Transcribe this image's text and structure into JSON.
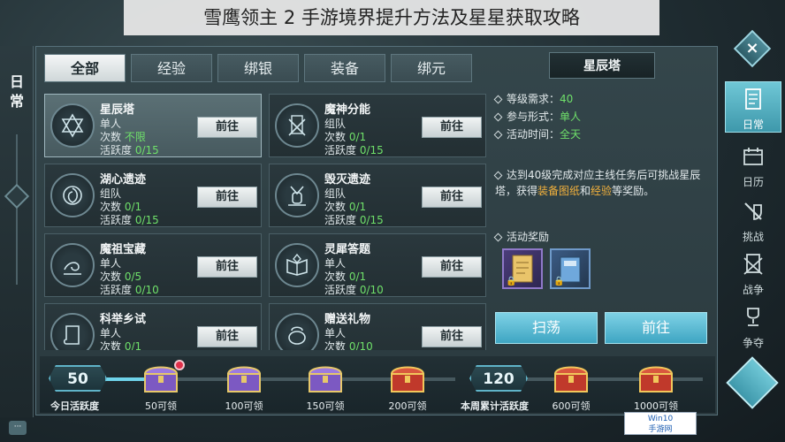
{
  "banner": {
    "title": "雪鹰领主 2 手游境界提升方法及星星获取攻略"
  },
  "left_rail": {
    "title": "日常"
  },
  "tabs": [
    {
      "label": "全部",
      "active": true
    },
    {
      "label": "经验",
      "active": false
    },
    {
      "label": "绑银",
      "active": false
    },
    {
      "label": "装备",
      "active": false
    },
    {
      "label": "绑元",
      "active": false
    }
  ],
  "tasks": [
    {
      "name": "星辰塔",
      "mode": "单人",
      "count_label": "次数",
      "count_value": "不限",
      "activity_label": "活跃度",
      "activity_value": "0/15",
      "button": "前往",
      "icon": "hexagram-icon",
      "selected": true
    },
    {
      "name": "魔神分能",
      "mode": "组队",
      "count_label": "次数",
      "count_value": "0/1",
      "activity_label": "活跃度",
      "activity_value": "0/15",
      "button": "前往",
      "icon": "banner-swords-icon",
      "selected": false
    },
    {
      "name": "湖心遗迹",
      "mode": "组队",
      "count_label": "次数",
      "count_value": "0/1",
      "activity_label": "活跃度",
      "activity_value": "0/15",
      "button": "前往",
      "icon": "vortex-icon",
      "selected": false
    },
    {
      "name": "毁灭遗迹",
      "mode": "组队",
      "count_label": "次数",
      "count_value": "0/1",
      "activity_label": "活跃度",
      "activity_value": "0/15",
      "button": "前往",
      "icon": "crossed-swords-icon",
      "selected": false
    },
    {
      "name": "魔祖宝藏",
      "mode": "单人",
      "count_label": "次数",
      "count_value": "0/5",
      "activity_label": "活跃度",
      "activity_value": "0/10",
      "button": "前往",
      "icon": "swirl-icon",
      "selected": false
    },
    {
      "name": "灵犀答题",
      "mode": "单人",
      "count_label": "次数",
      "count_value": "0/1",
      "activity_label": "活跃度",
      "activity_value": "0/10",
      "button": "前往",
      "icon": "book-icon",
      "selected": false
    },
    {
      "name": "科举乡试",
      "mode": "单人",
      "count_label": "次数",
      "count_value": "0/1",
      "activity_label": "",
      "activity_value": "",
      "button": "前往",
      "icon": "scroll-icon",
      "selected": false
    },
    {
      "name": "赠送礼物",
      "mode": "单人",
      "count_label": "次数",
      "count_value": "0/10",
      "activity_label": "",
      "activity_value": "",
      "button": "前往",
      "icon": "gift-bag-icon",
      "selected": false
    }
  ],
  "detail": {
    "title": "星辰塔",
    "level_label": "等级需求：",
    "level_value": "40",
    "mode_label": "参与形式：",
    "mode_value": "单人",
    "time_label": "活动时间：",
    "time_value": "全天",
    "desc_prefix": "达到40级完成对应主线任务后可挑战星辰塔，获得",
    "desc_highlight1": "装备图纸",
    "desc_mid": "和",
    "desc_highlight2": "经验",
    "desc_suffix": "等奖励。",
    "reward_label": "活动奖励",
    "sweep_button": "扫荡",
    "go_button": "前往"
  },
  "progress": {
    "today_value": "50",
    "today_label": "今日活跃度",
    "today_fraction": 0.12,
    "week_value": "120",
    "week_label": "本周累计活跃度",
    "week_fraction": 0.0,
    "chests": [
      {
        "label": "50可领",
        "has_dot": true
      },
      {
        "label": "100可领",
        "has_dot": false
      },
      {
        "label": "150可领",
        "has_dot": false
      },
      {
        "label": "200可领",
        "has_dot": false
      },
      {
        "label": "600可领",
        "has_dot": false
      },
      {
        "label": "1000可领",
        "has_dot": false
      }
    ]
  },
  "right_nav": [
    {
      "label": "日常",
      "icon": "scroll-book-icon",
      "active": true
    },
    {
      "label": "日历",
      "icon": "calendar-icon",
      "active": false
    },
    {
      "label": "挑战",
      "icon": "sword-shield-icon",
      "active": false
    },
    {
      "label": "战争",
      "icon": "war-banner-icon",
      "active": false
    },
    {
      "label": "争夺",
      "icon": "trophy-icon",
      "active": false
    }
  ],
  "watermark": {
    "line1": "Win10",
    "line2": "手游网"
  },
  "colors": {
    "accent": "#6fd3ea",
    "highlight_green": "#6fe06a",
    "highlight_orange": "#f2b13c",
    "selected_nav": "#4fb0c2"
  }
}
